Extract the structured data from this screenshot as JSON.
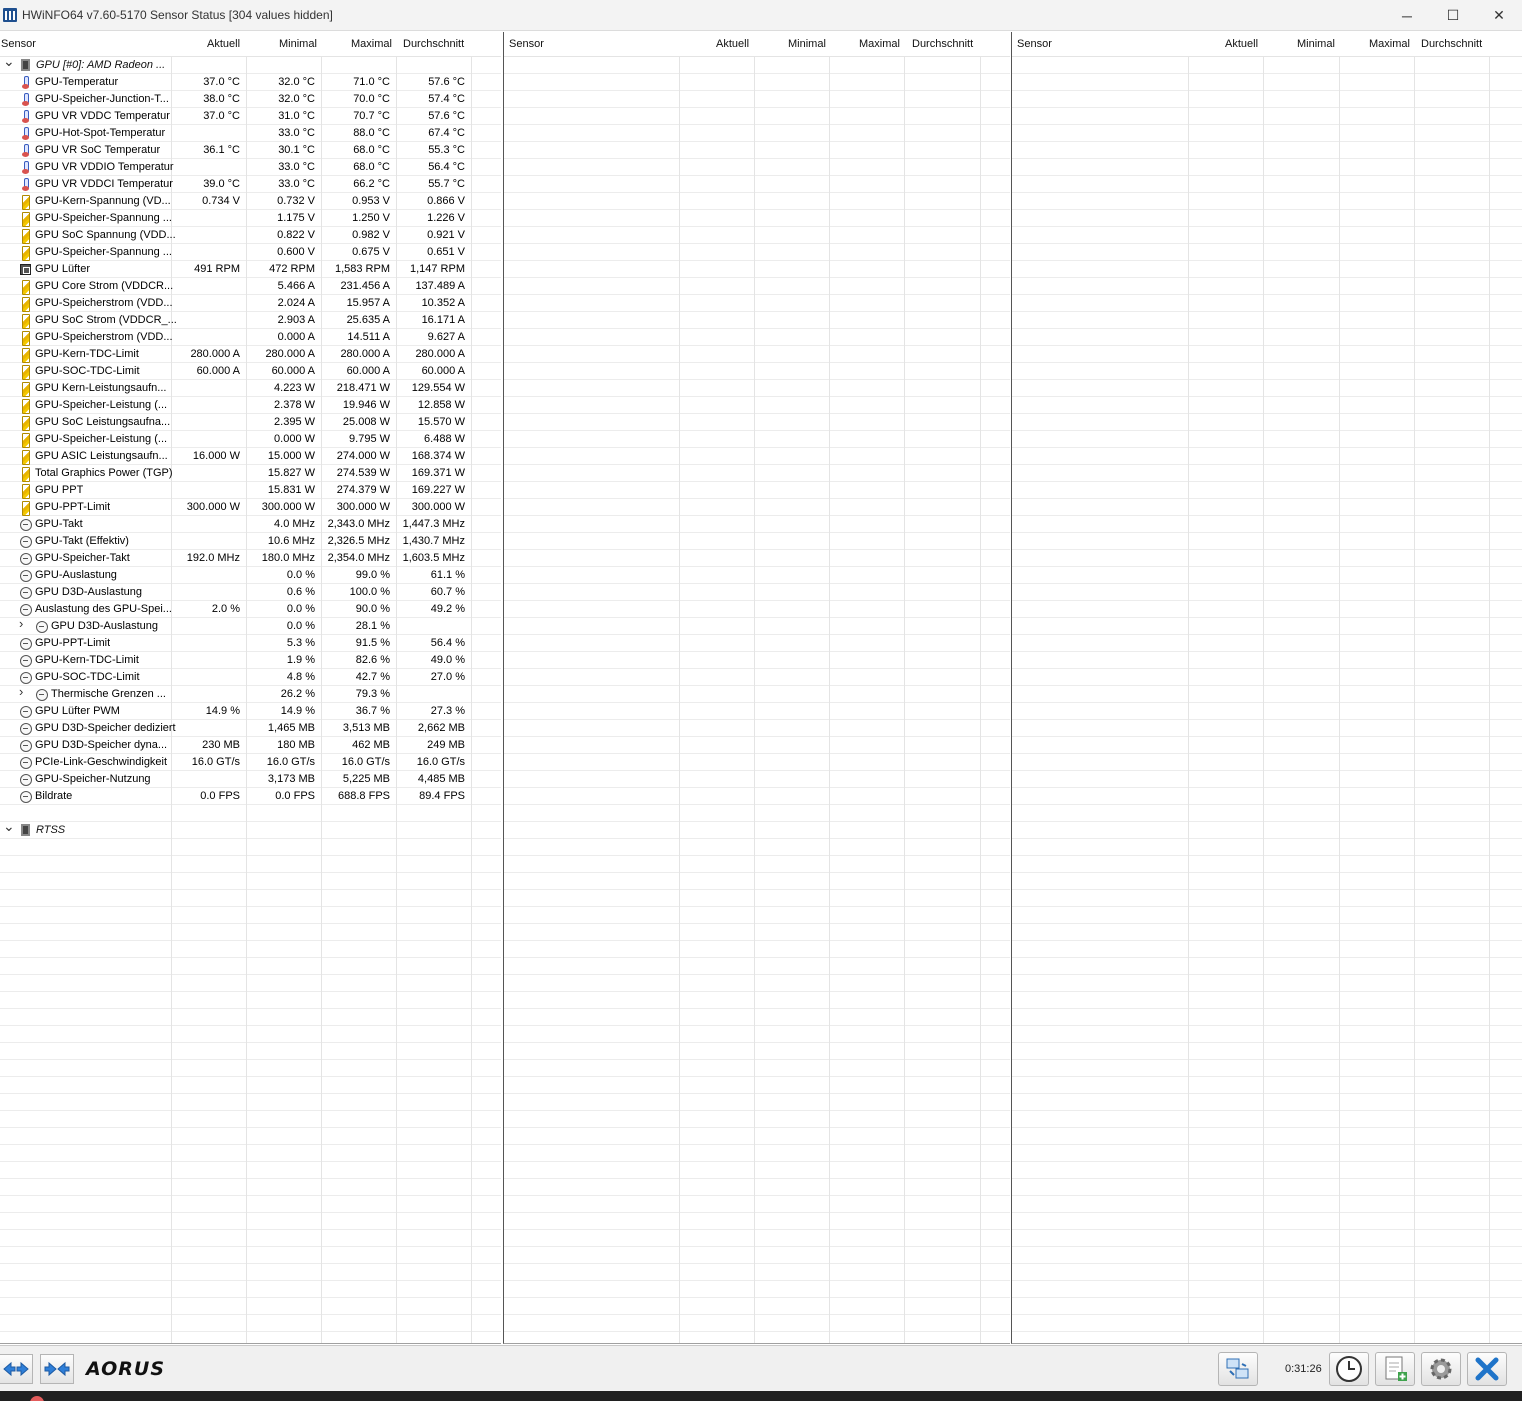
{
  "window": {
    "title": "HWiNFO64 v7.60-5170 Sensor Status [304 values hidden]",
    "minimize_label": "─",
    "maximize_label": "☐",
    "close_label": "✕"
  },
  "columns": [
    "Sensor",
    "Aktuell",
    "Minimal",
    "Maximal",
    "Durchschnitt"
  ],
  "panel1": {
    "groups": [
      {
        "name": "GPU [#0]: AMD Radeon ...",
        "icon": "chip-icon",
        "rows": [
          {
            "icon": "thermometer-icon",
            "name": "GPU-Temperatur",
            "current": "37.0 °C",
            "min": "32.0 °C",
            "max": "71.0 °C",
            "avg": "57.6 °C"
          },
          {
            "icon": "thermometer-icon",
            "name": "GPU-Speicher-Junction-T...",
            "current": "38.0 °C",
            "min": "32.0 °C",
            "max": "70.0 °C",
            "avg": "57.4 °C"
          },
          {
            "icon": "thermometer-icon",
            "name": "GPU VR VDDC Temperatur",
            "current": "37.0 °C",
            "min": "31.0 °C",
            "max": "70.7 °C",
            "avg": "57.6 °C"
          },
          {
            "icon": "thermometer-icon",
            "name": "GPU-Hot-Spot-Temperatur",
            "current": "",
            "min": "33.0 °C",
            "max": "88.0 °C",
            "avg": "67.4 °C"
          },
          {
            "icon": "thermometer-icon",
            "name": "GPU VR SoC Temperatur",
            "current": "36.1 °C",
            "min": "30.1 °C",
            "max": "68.0 °C",
            "avg": "55.3 °C"
          },
          {
            "icon": "thermometer-icon",
            "name": "GPU VR VDDIO Temperatur",
            "current": "",
            "min": "33.0 °C",
            "max": "68.0 °C",
            "avg": "56.4 °C"
          },
          {
            "icon": "thermometer-icon",
            "name": "GPU VR VDDCI Temperatur",
            "current": "39.0 °C",
            "min": "33.0 °C",
            "max": "66.2 °C",
            "avg": "55.7 °C"
          },
          {
            "icon": "bolt-icon",
            "name": "GPU-Kern-Spannung (VD...",
            "current": "0.734 V",
            "min": "0.732 V",
            "max": "0.953 V",
            "avg": "0.866 V"
          },
          {
            "icon": "bolt-icon",
            "name": "GPU-Speicher-Spannung ...",
            "current": "",
            "min": "1.175 V",
            "max": "1.250 V",
            "avg": "1.226 V"
          },
          {
            "icon": "bolt-icon",
            "name": "GPU SoC Spannung (VDD...",
            "current": "",
            "min": "0.822 V",
            "max": "0.982 V",
            "avg": "0.921 V"
          },
          {
            "icon": "bolt-icon",
            "name": "GPU-Speicher-Spannung ...",
            "current": "",
            "min": "0.600 V",
            "max": "0.675 V",
            "avg": "0.651 V"
          },
          {
            "icon": "fan-icon",
            "name": "GPU Lüfter",
            "current": "491 RPM",
            "min": "472 RPM",
            "max": "1,583 RPM",
            "avg": "1,147 RPM"
          },
          {
            "icon": "bolt-icon",
            "name": "GPU Core Strom (VDDCR...",
            "current": "",
            "min": "5.466 A",
            "max": "231.456 A",
            "avg": "137.489 A"
          },
          {
            "icon": "bolt-icon",
            "name": "GPU-Speicherstrom (VDD...",
            "current": "",
            "min": "2.024 A",
            "max": "15.957 A",
            "avg": "10.352 A"
          },
          {
            "icon": "bolt-icon",
            "name": "GPU SoC Strom (VDDCR_...",
            "current": "",
            "min": "2.903 A",
            "max": "25.635 A",
            "avg": "16.171 A"
          },
          {
            "icon": "bolt-icon",
            "name": "GPU-Speicherstrom (VDD...",
            "current": "",
            "min": "0.000 A",
            "max": "14.511 A",
            "avg": "9.627 A"
          },
          {
            "icon": "bolt-icon",
            "name": "GPU-Kern-TDC-Limit",
            "current": "280.000 A",
            "min": "280.000 A",
            "max": "280.000 A",
            "avg": "280.000 A"
          },
          {
            "icon": "bolt-icon",
            "name": "GPU-SOC-TDC-Limit",
            "current": "60.000 A",
            "min": "60.000 A",
            "max": "60.000 A",
            "avg": "60.000 A"
          },
          {
            "icon": "bolt-icon",
            "name": "GPU Kern-Leistungsaufn...",
            "current": "",
            "min": "4.223 W",
            "max": "218.471 W",
            "avg": "129.554 W"
          },
          {
            "icon": "bolt-icon",
            "name": "GPU-Speicher-Leistung (...",
            "current": "",
            "min": "2.378 W",
            "max": "19.946 W",
            "avg": "12.858 W"
          },
          {
            "icon": "bolt-icon",
            "name": "GPU SoC Leistungsaufna...",
            "current": "",
            "min": "2.395 W",
            "max": "25.008 W",
            "avg": "15.570 W"
          },
          {
            "icon": "bolt-icon",
            "name": "GPU-Speicher-Leistung (...",
            "current": "",
            "min": "0.000 W",
            "max": "9.795 W",
            "avg": "6.488 W"
          },
          {
            "icon": "bolt-icon",
            "name": "GPU ASIC Leistungsaufn...",
            "current": "16.000 W",
            "min": "15.000 W",
            "max": "274.000 W",
            "avg": "168.374 W"
          },
          {
            "icon": "bolt-icon",
            "name": "Total Graphics Power (TGP)",
            "current": "",
            "min": "15.827 W",
            "max": "274.539 W",
            "avg": "169.371 W"
          },
          {
            "icon": "bolt-icon",
            "name": "GPU PPT",
            "current": "",
            "min": "15.831 W",
            "max": "274.379 W",
            "avg": "169.227 W"
          },
          {
            "icon": "bolt-icon",
            "name": "GPU-PPT-Limit",
            "current": "300.000 W",
            "min": "300.000 W",
            "max": "300.000 W",
            "avg": "300.000 W"
          },
          {
            "icon": "clock-icon",
            "name": "GPU-Takt",
            "current": "",
            "min": "4.0 MHz",
            "max": "2,343.0 MHz",
            "avg": "1,447.3 MHz"
          },
          {
            "icon": "clock-icon",
            "name": "GPU-Takt (Effektiv)",
            "current": "",
            "min": "10.6 MHz",
            "max": "2,326.5 MHz",
            "avg": "1,430.7 MHz"
          },
          {
            "icon": "clock-icon",
            "name": "GPU-Speicher-Takt",
            "current": "192.0 MHz",
            "min": "180.0 MHz",
            "max": "2,354.0 MHz",
            "avg": "1,603.5 MHz"
          },
          {
            "icon": "clock-icon",
            "name": "GPU-Auslastung",
            "current": "",
            "min": "0.0 %",
            "max": "99.0 %",
            "avg": "61.1 %"
          },
          {
            "icon": "clock-icon",
            "name": "GPU D3D-Auslastung",
            "current": "",
            "min": "0.6 %",
            "max": "100.0 %",
            "avg": "60.7 %"
          },
          {
            "icon": "clock-icon",
            "name": "Auslastung des GPU-Spei...",
            "current": "2.0 %",
            "min": "0.0 %",
            "max": "90.0 %",
            "avg": "49.2 %"
          },
          {
            "icon": "clock-icon",
            "name": "GPU D3D-Auslastung",
            "current": "",
            "min": "0.0 %",
            "max": "28.1 %",
            "avg": "",
            "expandable": true
          },
          {
            "icon": "clock-icon",
            "name": "GPU-PPT-Limit",
            "current": "",
            "min": "5.3 %",
            "max": "91.5 %",
            "avg": "56.4 %"
          },
          {
            "icon": "clock-icon",
            "name": "GPU-Kern-TDC-Limit",
            "current": "",
            "min": "1.9 %",
            "max": "82.6 %",
            "avg": "49.0 %"
          },
          {
            "icon": "clock-icon",
            "name": "GPU-SOC-TDC-Limit",
            "current": "",
            "min": "4.8 %",
            "max": "42.7 %",
            "avg": "27.0 %"
          },
          {
            "icon": "clock-icon",
            "name": "Thermische Grenzen ...",
            "current": "",
            "min": "26.2 %",
            "max": "79.3 %",
            "avg": "",
            "expandable": true
          },
          {
            "icon": "clock-icon",
            "name": "GPU Lüfter PWM",
            "current": "14.9 %",
            "min": "14.9 %",
            "max": "36.7 %",
            "avg": "27.3 %"
          },
          {
            "icon": "clock-icon",
            "name": "GPU D3D-Speicher dediziert",
            "current": "",
            "min": "1,465 MB",
            "max": "3,513 MB",
            "avg": "2,662 MB"
          },
          {
            "icon": "clock-icon",
            "name": "GPU D3D-Speicher dyna...",
            "current": "230 MB",
            "min": "180 MB",
            "max": "462 MB",
            "avg": "249 MB"
          },
          {
            "icon": "clock-icon",
            "name": "PCIe-Link-Geschwindigkeit",
            "current": "16.0 GT/s",
            "min": "16.0 GT/s",
            "max": "16.0 GT/s",
            "avg": "16.0 GT/s"
          },
          {
            "icon": "clock-icon",
            "name": "GPU-Speicher-Nutzung",
            "current": "",
            "min": "3,173 MB",
            "max": "5,225 MB",
            "avg": "4,485 MB"
          },
          {
            "icon": "clock-icon",
            "name": "Bildrate",
            "current": "0.0 FPS",
            "min": "0.0 FPS",
            "max": "688.8 FPS",
            "avg": "89.4 FPS"
          }
        ]
      },
      {
        "name": "RTSS",
        "icon": "chip-icon",
        "rows": []
      }
    ]
  },
  "footer": {
    "timer": "0:31:26",
    "brand": "AORUS",
    "buttons": [
      "prev-sensor-icon",
      "collapse-icon",
      "network-icon",
      "clock-reset-icon",
      "log-add-icon",
      "settings-icon",
      "close-x-icon"
    ]
  }
}
